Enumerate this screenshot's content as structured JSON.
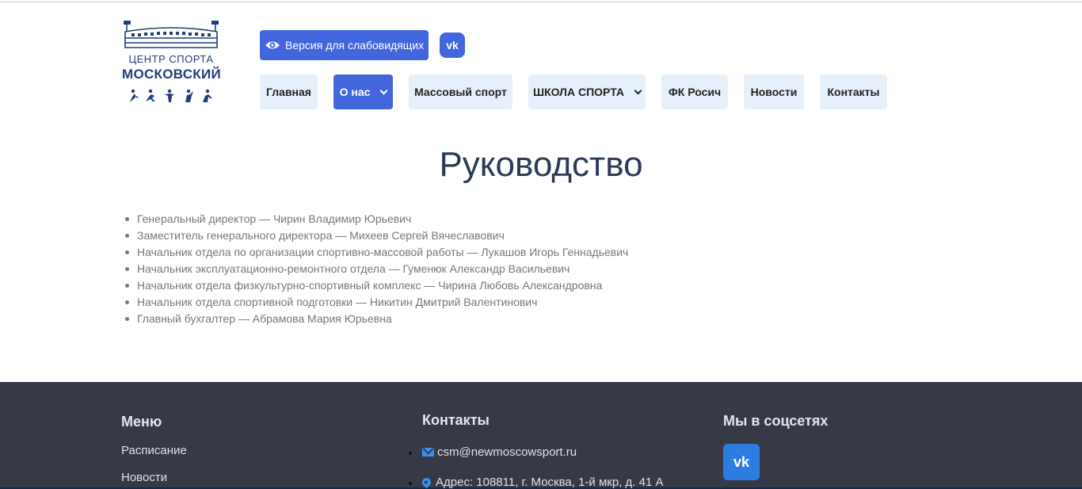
{
  "logo": {
    "line1": "ЦЕНТР СПОРТА",
    "line2": "МОСКОВСКИЙ"
  },
  "header": {
    "vision_label": "Версия для слабовидящих",
    "vk_icon": "vk-icon",
    "vk_label": "vk"
  },
  "nav": {
    "items": [
      {
        "label": "Главная"
      },
      {
        "label": "О нас"
      },
      {
        "label": "Массовый спорт"
      },
      {
        "label": "ШКОЛА СПОРТА"
      },
      {
        "label": "ФК Росич"
      },
      {
        "label": "Новости"
      },
      {
        "label": "Контакты"
      }
    ],
    "active": "О нас"
  },
  "page": {
    "title": "Руководство",
    "staff": [
      "Генеральный директор — Чирин Владимир Юрьевич",
      "Заместитель генерального директора — Михеев Сергей Вячеславович",
      "Начальник отдела по организации спортивно-массовой работы — Лукашов Игорь Геннадьевич",
      "Начальник эксплуатационно-ремонтного отдела — Гуменюк Александр Васильевич",
      "Начальник отдела физкультурно-спортивный комплекс — Чирина Любовь Александровна",
      "Начальник отдела спортивной подготовки — Никитин Дмитрий Валентинович",
      "Главный бухгалтер — Абрамова Мария Юрьевна"
    ]
  },
  "footer": {
    "menu_title": "Меню",
    "menu_items": [
      "Расписание",
      "Новости"
    ],
    "contacts_title": "Контакты",
    "email": "csm@newmoscowsport.ru",
    "address": "Адрес: 108811, г. Москва, 1-й мкр, д. 41 А",
    "social_title": "Мы в соцсетях",
    "social_vk_label": "vk"
  },
  "colors": {
    "accent": "#4466dd",
    "nav_bg": "#e6f0fa",
    "footer_bg": "#363a47",
    "icon_blue": "#3b8ff0"
  }
}
